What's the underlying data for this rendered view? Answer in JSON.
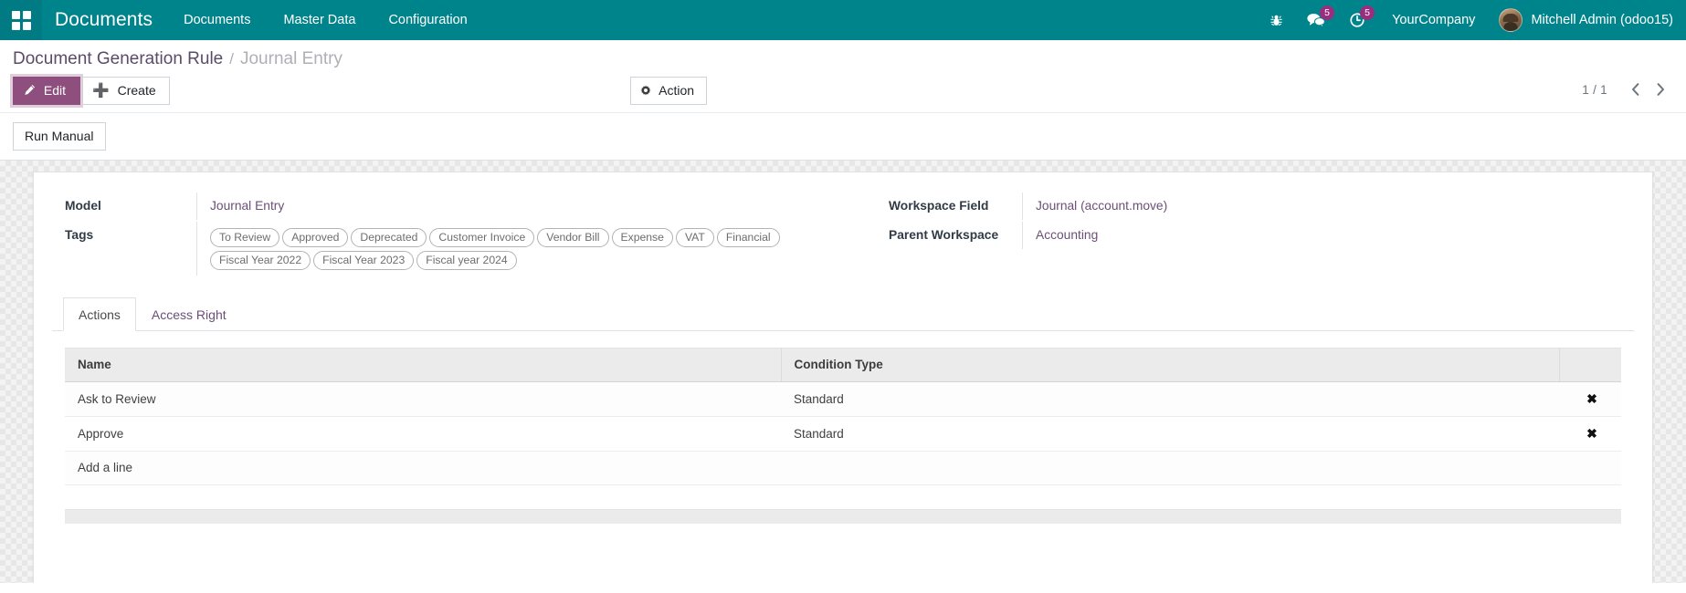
{
  "navbar": {
    "apps_icon": "grid-apps-icon",
    "brand": "Documents",
    "menu_items": [
      {
        "label": "Documents"
      },
      {
        "label": "Master Data"
      },
      {
        "label": "Configuration"
      }
    ],
    "debug_icon": "bug-icon",
    "messages_icon": "messages-icon",
    "messages_count": "5",
    "activities_icon": "clock-activity-icon",
    "activities_count": "5",
    "company": "YourCompany",
    "user": "Mitchell Admin (odoo15)",
    "avatar_icon": "user-avatar",
    "bg_color": "#00848c",
    "badge_color": "#9b2d7f"
  },
  "breadcrumb": {
    "parent": "Document Generation Rule",
    "separator": "/",
    "current": "Journal Entry"
  },
  "toolbar": {
    "edit_label": "Edit",
    "edit_icon": "pencil-icon",
    "edit_color": "#8f4f7e",
    "create_label": "Create",
    "create_icon": "plus-icon",
    "action_label": "Action",
    "action_icon": "gear-icon",
    "pager_value": "1 / 1",
    "prev_icon": "chevron-left-icon",
    "next_icon": "chevron-right-icon"
  },
  "statbar": {
    "run_manual_label": "Run Manual"
  },
  "form": {
    "left": [
      {
        "label": "Model",
        "value": "Journal Entry",
        "type": "link"
      },
      {
        "label": "Tags",
        "type": "tags"
      }
    ],
    "tags": [
      "To Review",
      "Approved",
      "Deprecated",
      "Customer Invoice",
      "Vendor Bill",
      "Expense",
      "VAT",
      "Financial",
      "Fiscal Year 2022",
      "Fiscal Year 2023",
      "Fiscal year 2024"
    ],
    "right": [
      {
        "label": "Workspace Field",
        "value": "Journal (account.move)",
        "type": "text"
      },
      {
        "label": "Parent Workspace",
        "value": "Accounting",
        "type": "link"
      }
    ]
  },
  "notebook": {
    "tabs": [
      {
        "label": "Actions",
        "active": true
      },
      {
        "label": "Access Right",
        "active": false
      }
    ]
  },
  "table": {
    "columns": [
      "Name",
      "Condition Type"
    ],
    "rows": [
      {
        "name": "Ask to Review",
        "condition_type": "Standard",
        "delete_icon": "close-x-icon"
      },
      {
        "name": "Approve",
        "condition_type": "Standard",
        "delete_icon": "close-x-icon"
      }
    ],
    "add_line_label": "Add a line"
  }
}
